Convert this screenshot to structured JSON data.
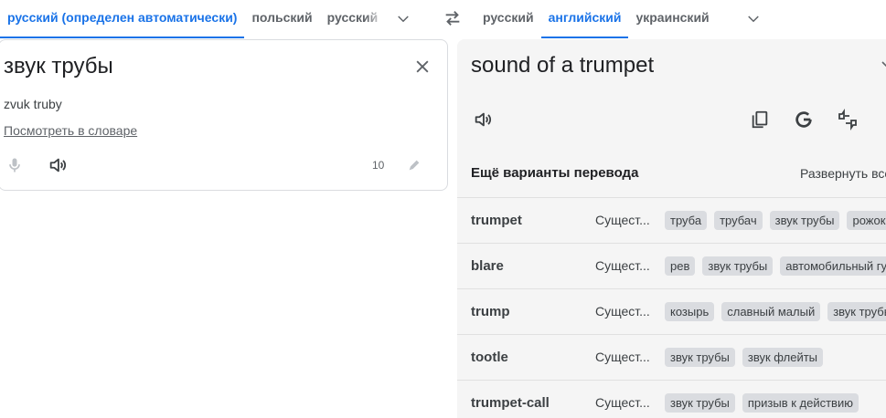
{
  "source_langs": {
    "detected": "русский (определен автоматически)",
    "lang1": "польский",
    "lang2": "русский"
  },
  "target_langs": {
    "lang1": "русский",
    "lang2": "английский",
    "lang3": "украинский"
  },
  "source": {
    "text": "звук трубы",
    "transliteration": "zvuk truby",
    "dictionary_link": "Посмотреть в словаре",
    "char_count": "10"
  },
  "target": {
    "text": "sound of a trumpet"
  },
  "alternatives": {
    "title": "Ещё варианты перевода",
    "expand": "Развернуть все",
    "rows": [
      {
        "word": "trumpet",
        "pos": "Сущест...",
        "chips": [
          "труба",
          "трубач",
          "звук трубы",
          "рожок"
        ]
      },
      {
        "word": "blare",
        "pos": "Сущест...",
        "chips": [
          "рев",
          "звук трубы",
          "автомобильный гудок"
        ]
      },
      {
        "word": "trump",
        "pos": "Сущест...",
        "chips": [
          "козырь",
          "славный малый",
          "звук трубы"
        ]
      },
      {
        "word": "tootle",
        "pos": "Сущест...",
        "chips": [
          "звук трубы",
          "звук флейты"
        ]
      },
      {
        "word": "trumpet-call",
        "pos": "Сущест...",
        "chips": [
          "звук трубы",
          "призыв к действию"
        ]
      }
    ]
  },
  "colors": {
    "accent": "#1a73e8",
    "panel_bg": "#f5f5f5",
    "chip_bg": "#dadce0"
  }
}
